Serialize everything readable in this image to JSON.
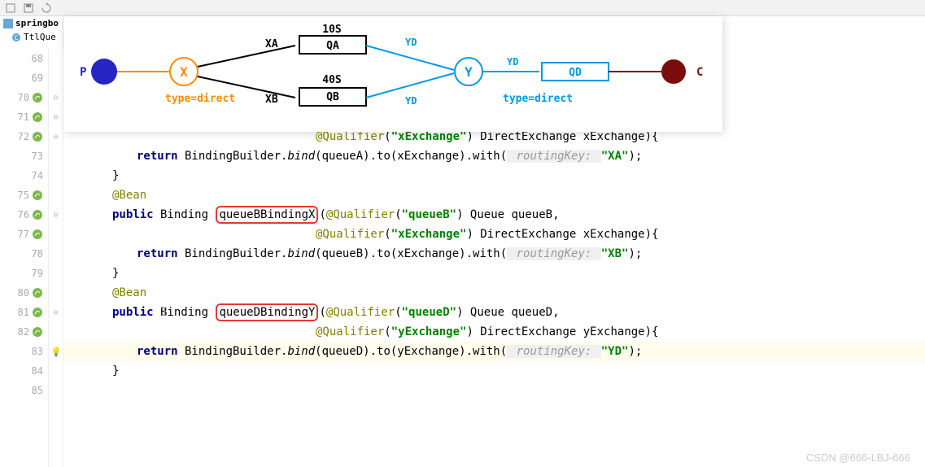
{
  "toolbar": {},
  "sidebar": {
    "project": "springbo",
    "file": "TtlQue"
  },
  "diagram": {
    "p_label": "P",
    "x_label": "X",
    "x_type": "type=direct",
    "xa_label": "XA",
    "xb_label": "XB",
    "qa_ttl": "10S",
    "qa_label": "QA",
    "qb_ttl": "40S",
    "qb_label": "QB",
    "yd1": "YD",
    "yd2": "YD",
    "y_label": "Y",
    "yd3": "YD",
    "y_type": "type=direct",
    "qd_label": "QD",
    "c_label": "C"
  },
  "lines": {
    "68": "68",
    "69": "69",
    "70": "70",
    "71": "71",
    "72": "72",
    "73": "73",
    "74": "74",
    "75": "75",
    "76": "76",
    "77": "77",
    "78": "78",
    "79": "79",
    "80": "80",
    "81": "81",
    "82": "82",
    "83": "83",
    "84": "84",
    "85": "85"
  },
  "code": {
    "l72_qualifier": "@Qualifier",
    "l72_str": "\"xExchange\"",
    "l72_rest": ") DirectExchange xExchange){",
    "l73_return": "return",
    "l73_a": " BindingBuilder.",
    "l73_bind": "bind",
    "l73_b": "(queueA).to(xExchange).with(",
    "l73_hint": " routingKey: ",
    "l73_str": "\"XA\"",
    "l73_end": ");",
    "l74": "}",
    "l75": "@Bean",
    "l76_public": "public",
    "l76_a": " Binding ",
    "l76_method": "queueBBindingX",
    "l76_b": "(",
    "l76_qualifier": "@Qualifier",
    "l76_str": "\"queueB\"",
    "l76_c": ") Queue queueB,",
    "l77_qualifier": "@Qualifier",
    "l77_str": "\"xExchange\"",
    "l77_rest": ") DirectExchange xExchange){",
    "l78_return": "return",
    "l78_a": " BindingBuilder.",
    "l78_bind": "bind",
    "l78_b": "(queueB).to(xExchange).with(",
    "l78_hint": " routingKey: ",
    "l78_str": "\"XB\"",
    "l78_end": ");",
    "l79": "}",
    "l80": "@Bean",
    "l81_public": "public",
    "l81_a": " Binding ",
    "l81_method": "queueDBindingY",
    "l81_b": "(",
    "l81_qualifier": "@Qualifier",
    "l81_str": "\"queueD\"",
    "l81_c": ") Queue queueD,",
    "l82_qualifier": "@Qualifier",
    "l82_str": "\"yExchange\"",
    "l82_rest": ") DirectExchange yExchange){",
    "l83_return": "return",
    "l83_a": " BindingBuilder.",
    "l83_bind": "bind",
    "l83_b": "(queueD).to(yExchange).with(",
    "l83_hint": " routingKey: ",
    "l83_str": "\"YD\"",
    "l83_end": ");",
    "l84": "}"
  },
  "watermark": "CSDN @666-LBJ-666"
}
